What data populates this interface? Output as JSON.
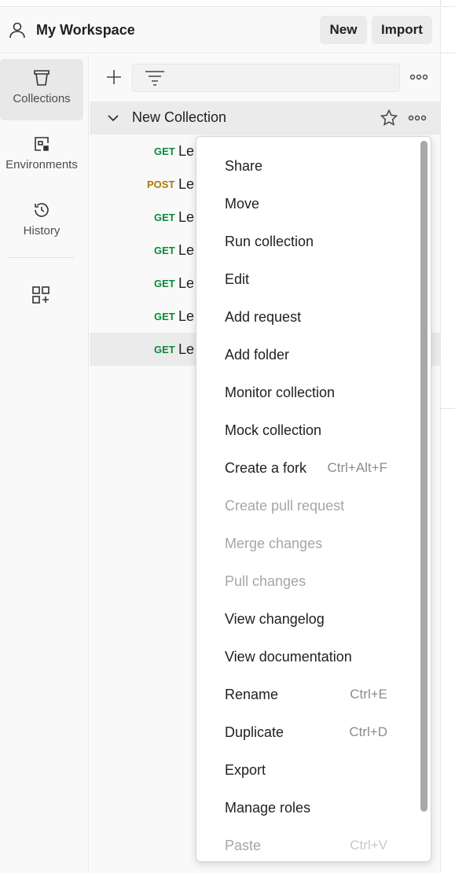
{
  "header": {
    "workspace_title": "My Workspace",
    "new_label": "New",
    "import_label": "Import"
  },
  "sidebar": {
    "items": [
      {
        "label": "Collections",
        "icon": "collections-icon",
        "active": true
      },
      {
        "label": "Environments",
        "icon": "environments-icon",
        "active": false
      },
      {
        "label": "History",
        "icon": "history-icon",
        "active": false
      }
    ],
    "extra_icon": "add-widget-icon"
  },
  "collections": {
    "filter_placeholder": "",
    "collection": {
      "name": "New Collection",
      "requests": [
        {
          "method": "GET",
          "name": "Le"
        },
        {
          "method": "POST",
          "name": "Le"
        },
        {
          "method": "GET",
          "name": "Le"
        },
        {
          "method": "GET",
          "name": "Le"
        },
        {
          "method": "GET",
          "name": "Le"
        },
        {
          "method": "GET",
          "name": "Le"
        },
        {
          "method": "GET",
          "name": "Le",
          "selected": true
        }
      ]
    }
  },
  "context_menu": {
    "items": [
      {
        "label": "Share",
        "shortcut": "",
        "disabled": false
      },
      {
        "label": "Move",
        "shortcut": "",
        "disabled": false
      },
      {
        "label": "Run collection",
        "shortcut": "",
        "disabled": false
      },
      {
        "label": "Edit",
        "shortcut": "",
        "disabled": false
      },
      {
        "label": "Add request",
        "shortcut": "",
        "disabled": false
      },
      {
        "label": "Add folder",
        "shortcut": "",
        "disabled": false
      },
      {
        "label": "Monitor collection",
        "shortcut": "",
        "disabled": false
      },
      {
        "label": "Mock collection",
        "shortcut": "",
        "disabled": false
      },
      {
        "label": "Create a fork",
        "shortcut": "Ctrl+Alt+F",
        "disabled": false
      },
      {
        "label": "Create pull request",
        "shortcut": "",
        "disabled": true
      },
      {
        "label": "Merge changes",
        "shortcut": "",
        "disabled": true
      },
      {
        "label": "Pull changes",
        "shortcut": "",
        "disabled": true
      },
      {
        "label": "View changelog",
        "shortcut": "",
        "disabled": false
      },
      {
        "label": "View documentation",
        "shortcut": "",
        "disabled": false
      },
      {
        "label": "Rename",
        "shortcut": "Ctrl+E",
        "disabled": false
      },
      {
        "label": "Duplicate",
        "shortcut": "Ctrl+D",
        "disabled": false
      },
      {
        "label": "Export",
        "shortcut": "",
        "disabled": false
      },
      {
        "label": "Manage roles",
        "shortcut": "",
        "disabled": false
      },
      {
        "label": "Paste",
        "shortcut": "Ctrl+V",
        "disabled": true
      }
    ]
  },
  "colors": {
    "get_method": "#0b8a3a",
    "post_method": "#ad7a03",
    "sidebar_bg": "#f9f9f9",
    "active_bg": "#e8e8e8"
  }
}
